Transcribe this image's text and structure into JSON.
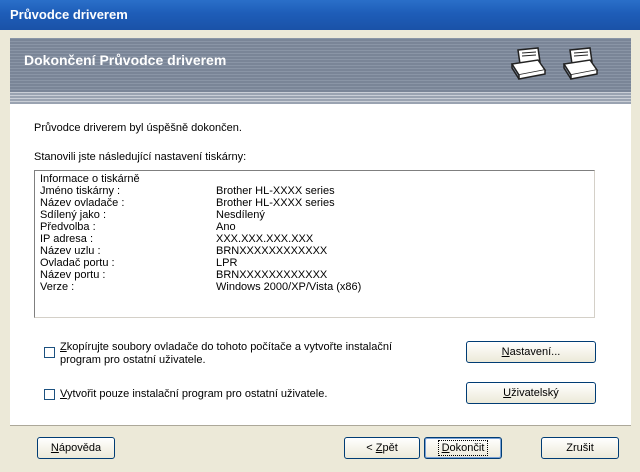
{
  "window": {
    "title": "Průvodce driverem"
  },
  "banner": {
    "title": "Dokončení Průvodce driverem"
  },
  "main": {
    "success_text": "Průvodce driverem byl úspěšně dokončen.",
    "settings_intro": "Stanovili jste následující nastavení tiskárny:"
  },
  "info": {
    "heading": "Informace o tiskárně",
    "rows": [
      {
        "key": "Jméno tiskárny  :",
        "value": "Brother HL-XXXX series"
      },
      {
        "key": "Název ovladače :",
        "value": "Brother HL-XXXX series"
      },
      {
        "key": "Sdílený jako :",
        "value": "Nesdílený"
      },
      {
        "key": "Předvolba :",
        "value": "Ano"
      },
      {
        "key": "IP adresa :",
        "value": "XXX.XXX.XXX.XXX"
      },
      {
        "key": "Název uzlu :",
        "value": "BRNXXXXXXXXXXXX"
      },
      {
        "key": "Ovladač portu :",
        "value": "LPR"
      },
      {
        "key": "Název portu :",
        "value": "BRNXXXXXXXXXXXX"
      },
      {
        "key": "Verze :",
        "value": "Windows 2000/XP/Vista (x86)"
      }
    ]
  },
  "options": {
    "copy_drivers": {
      "line1_underlined": "Z",
      "line1_rest": "kopírujte soubory ovladače do tohoto počítače a vytvořte instalační",
      "line2": "program pro ostatní uživatele.",
      "checked": false
    },
    "installer_only": {
      "underlined": "V",
      "rest": "ytvořit pouze instalační program pro ostatní uživatele.",
      "checked": false
    }
  },
  "buttons": {
    "settings": {
      "u": "N",
      "rest": "astavení..."
    },
    "custom": {
      "u": "U",
      "rest": "živatelský"
    },
    "help": {
      "u": "N",
      "rest": "ápověda"
    },
    "back": {
      "pre": "< ",
      "u": "Z",
      "rest": "pět"
    },
    "finish": {
      "u": "D",
      "rest": "okončit"
    },
    "cancel": {
      "label": "Zrušit"
    }
  },
  "icons": [
    "printer-icon",
    "printer-icon"
  ]
}
